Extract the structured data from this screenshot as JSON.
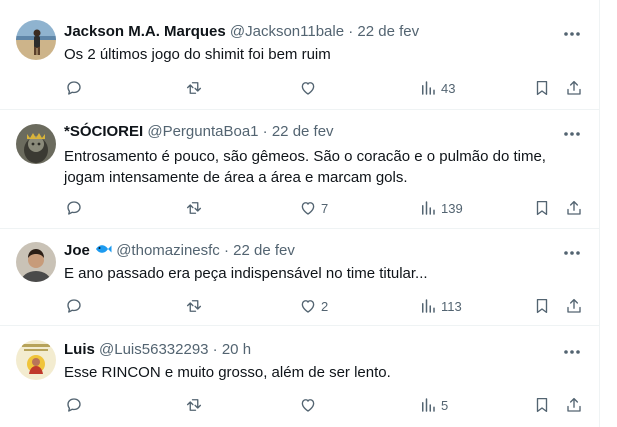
{
  "tweets": [
    {
      "name": "Jackson M.A. Marques",
      "name_emoji": "",
      "handle": "@Jackson11bale",
      "separator": "·",
      "time": "22 de fev",
      "text_lines": [
        "Os 2 últimos jogo do shimit foi bem ruim"
      ],
      "replies": "",
      "retweets": "",
      "likes": "",
      "views": "43",
      "avatar": "avatar-beach-photo"
    },
    {
      "name": "*SÓCIOREI",
      "name_emoji": "",
      "handle": "@PerguntaBoa1",
      "separator": "·",
      "time": "22 de fev",
      "text_lines": [
        "Entrosamento é pouco, são gêmeos. São o coracão e o pulmão do time,",
        "jogam intensamente de área a área e marcam gols."
      ],
      "replies": "",
      "retweets": "",
      "likes": "7",
      "views": "139",
      "avatar": "avatar-crowned-figure"
    },
    {
      "name": "Joe",
      "name_emoji": "fish-emoji",
      "handle": "@thomazinesfc",
      "separator": "·",
      "time": "22 de fev",
      "text_lines": [
        "E ano passado era peça indispensável no time titular..."
      ],
      "replies": "",
      "retweets": "",
      "likes": "2",
      "views": "113",
      "avatar": "avatar-person-photo"
    },
    {
      "name": "Luis",
      "name_emoji": "",
      "handle": "@Luis56332293",
      "separator": "·",
      "time": "20 h",
      "text_lines": [
        "Esse RINCON e muito grosso, além de ser lento."
      ],
      "replies": "",
      "retweets": "",
      "likes": "",
      "views": "5",
      "avatar": "avatar-religious-image"
    }
  ],
  "colors": {
    "text": "#0f1419",
    "secondary": "#536471",
    "border": "#eff3f4",
    "fish": "#1d9bf0"
  },
  "icons": [
    "reply-icon",
    "retweet-icon",
    "like-icon",
    "views-icon",
    "bookmark-icon",
    "share-icon",
    "more-icon"
  ]
}
